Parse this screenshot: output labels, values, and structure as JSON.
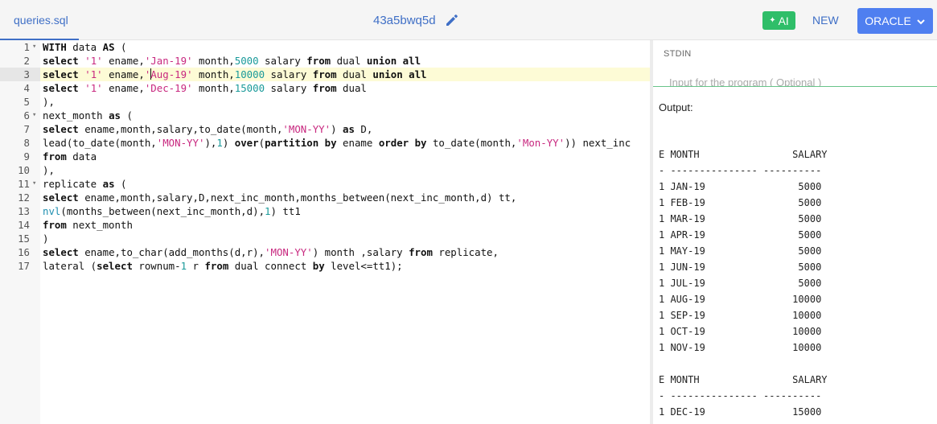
{
  "file_tab": "queries.sql",
  "title": "43a5bwq5d",
  "ai_label": "AI",
  "new_label": "NEW",
  "language_label": "ORACLE",
  "editor": {
    "active_line": 3,
    "lines": [
      {
        "n": "1",
        "fold": true,
        "tokens": [
          {
            "t": "WITH",
            "c": "kw"
          },
          {
            "t": " data "
          },
          {
            "t": "AS",
            "c": "kw"
          },
          {
            "t": " ("
          }
        ]
      },
      {
        "n": "2",
        "tokens": [
          {
            "t": "select",
            "c": "kw"
          },
          {
            "t": " "
          },
          {
            "t": "'1'",
            "c": "str"
          },
          {
            "t": " ename,"
          },
          {
            "t": "'Jan-19'",
            "c": "str"
          },
          {
            "t": " month,"
          },
          {
            "t": "5000",
            "c": "num-lit"
          },
          {
            "t": " salary "
          },
          {
            "t": "from",
            "c": "kw"
          },
          {
            "t": " dual "
          },
          {
            "t": "union all",
            "c": "kw"
          }
        ]
      },
      {
        "n": "3",
        "tokens": [
          {
            "t": "select",
            "c": "kw"
          },
          {
            "t": " "
          },
          {
            "t": "'1'",
            "c": "str"
          },
          {
            "t": " ename,"
          },
          {
            "t": "'",
            "c": "str"
          },
          {
            "t": "",
            "c": "cursor"
          },
          {
            "t": "Aug-19'",
            "c": "str"
          },
          {
            "t": " month,"
          },
          {
            "t": "10000",
            "c": "num-lit"
          },
          {
            "t": " salary "
          },
          {
            "t": "from",
            "c": "kw"
          },
          {
            "t": " dual "
          },
          {
            "t": "union all",
            "c": "kw"
          }
        ]
      },
      {
        "n": "4",
        "tokens": [
          {
            "t": "select",
            "c": "kw"
          },
          {
            "t": " "
          },
          {
            "t": "'1'",
            "c": "str"
          },
          {
            "t": " ename,"
          },
          {
            "t": "'Dec-19'",
            "c": "str"
          },
          {
            "t": " month,"
          },
          {
            "t": "15000",
            "c": "num-lit"
          },
          {
            "t": " salary "
          },
          {
            "t": "from",
            "c": "kw"
          },
          {
            "t": " dual"
          }
        ]
      },
      {
        "n": "5",
        "tokens": [
          {
            "t": "),"
          }
        ]
      },
      {
        "n": "6",
        "fold": true,
        "tokens": [
          {
            "t": "next_month "
          },
          {
            "t": "as",
            "c": "kw"
          },
          {
            "t": " ("
          }
        ]
      },
      {
        "n": "7",
        "tokens": [
          {
            "t": "select",
            "c": "kw"
          },
          {
            "t": " ename,month,salary,to_date(month,"
          },
          {
            "t": "'MON-YY'",
            "c": "str"
          },
          {
            "t": ") "
          },
          {
            "t": "as",
            "c": "kw"
          },
          {
            "t": " D,"
          }
        ]
      },
      {
        "n": "8",
        "tokens": [
          {
            "t": "lead(to_date(month,"
          },
          {
            "t": "'MON-YY'",
            "c": "str"
          },
          {
            "t": "),"
          },
          {
            "t": "1",
            "c": "num-lit"
          },
          {
            "t": ") "
          },
          {
            "t": "over",
            "c": "kw"
          },
          {
            "t": "("
          },
          {
            "t": "partition by",
            "c": "kw"
          },
          {
            "t": " ename "
          },
          {
            "t": "order by",
            "c": "kw"
          },
          {
            "t": " to_date(month,"
          },
          {
            "t": "'Mon-YY'",
            "c": "str"
          },
          {
            "t": ")) next_inc"
          }
        ]
      },
      {
        "n": "9",
        "tokens": [
          {
            "t": "from",
            "c": "kw"
          },
          {
            "t": " data"
          }
        ]
      },
      {
        "n": "10",
        "tokens": [
          {
            "t": "),"
          }
        ]
      },
      {
        "n": "11",
        "fold": true,
        "tokens": [
          {
            "t": "replicate "
          },
          {
            "t": "as",
            "c": "kw"
          },
          {
            "t": " ("
          }
        ]
      },
      {
        "n": "12",
        "tokens": [
          {
            "t": "select",
            "c": "kw"
          },
          {
            "t": " ename,month,salary,D,next_inc_month,months_between(next_inc_month,d) tt,"
          }
        ]
      },
      {
        "n": "13",
        "tokens": [
          {
            "t": "nvl",
            "c": "fn"
          },
          {
            "t": "(months_between(next_inc_month,d),"
          },
          {
            "t": "1",
            "c": "num-lit"
          },
          {
            "t": ") tt1"
          }
        ]
      },
      {
        "n": "14",
        "tokens": [
          {
            "t": "from",
            "c": "kw"
          },
          {
            "t": " next_month"
          }
        ]
      },
      {
        "n": "15",
        "tokens": [
          {
            "t": ")"
          }
        ]
      },
      {
        "n": "16",
        "tokens": [
          {
            "t": "select",
            "c": "kw"
          },
          {
            "t": " ename,to_char(add_months(d,r),"
          },
          {
            "t": "'MON-YY'",
            "c": "str"
          },
          {
            "t": ") month ,salary "
          },
          {
            "t": "from",
            "c": "kw"
          },
          {
            "t": " replicate,"
          }
        ]
      },
      {
        "n": "17",
        "tokens": [
          {
            "t": "lateral ("
          },
          {
            "t": "select",
            "c": "kw"
          },
          {
            "t": " rownum-"
          },
          {
            "t": "1",
            "c": "num-lit"
          },
          {
            "t": " r "
          },
          {
            "t": "from",
            "c": "kw"
          },
          {
            "t": " dual connect "
          },
          {
            "t": "by",
            "c": "kw"
          },
          {
            "t": " level<=tt1);"
          }
        ]
      }
    ]
  },
  "stdin": {
    "label": "STDIN",
    "placeholder": "Input for the program ( Optional )"
  },
  "output": {
    "label": "Output:",
    "lines": [
      "",
      "",
      "E MONTH                SALARY",
      "- --------------- ----------",
      "1 JAN-19                5000",
      "1 FEB-19                5000",
      "1 MAR-19                5000",
      "1 APR-19                5000",
      "1 MAY-19                5000",
      "1 JUN-19                5000",
      "1 JUL-19                5000",
      "1 AUG-19               10000",
      "1 SEP-19               10000",
      "1 OCT-19               10000",
      "1 NOV-19               10000",
      "",
      "E MONTH                SALARY",
      "- --------------- ----------",
      "1 DEC-19               15000"
    ]
  }
}
